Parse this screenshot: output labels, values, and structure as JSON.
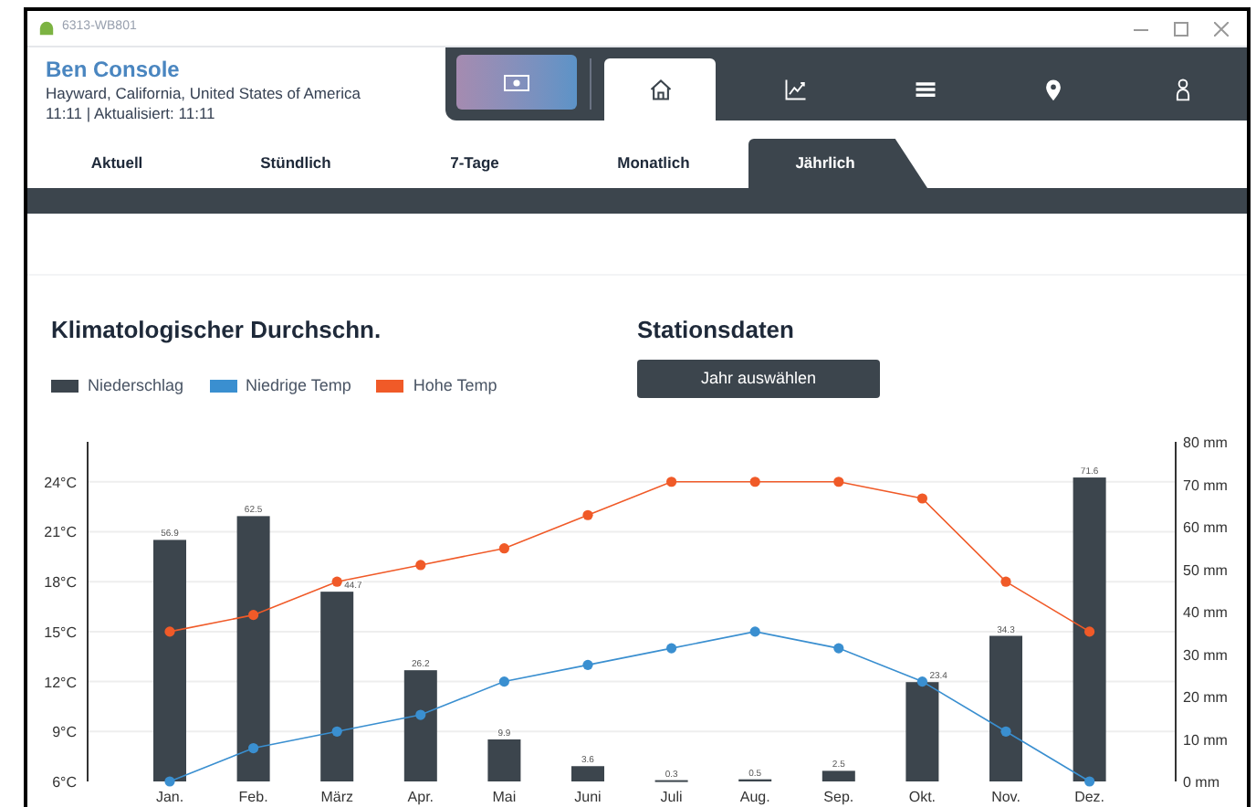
{
  "window": {
    "title": "6313-WB801"
  },
  "header": {
    "station": "Ben Console",
    "location": "Hayward, California, United States of America",
    "updated": "11:11 | Aktualisiert: 11:11"
  },
  "nav": [
    {
      "kind": "home",
      "selected": true
    },
    {
      "kind": "chart",
      "selected": false
    },
    {
      "kind": "list",
      "selected": false
    },
    {
      "kind": "pin",
      "selected": false
    },
    {
      "kind": "person",
      "selected": false
    }
  ],
  "tabs": [
    {
      "label": "Aktuell",
      "selected": false
    },
    {
      "label": "Stündlich",
      "selected": false
    },
    {
      "label": "7-Tage",
      "selected": false
    },
    {
      "label": "Monatlich",
      "selected": false
    },
    {
      "label": "Jährlich",
      "selected": true
    }
  ],
  "climate": {
    "title": "Klimatologischer Durchschn.",
    "chart_data": {
      "type": "bar",
      "categories": [
        "Jan.",
        "Feb.",
        "März",
        "Apr.",
        "Mai",
        "Juni",
        "Juli",
        "Aug.",
        "Sep.",
        "Okt.",
        "Nov.",
        "Dez."
      ],
      "series": [
        {
          "name": "Niederschlag",
          "type": "bar",
          "axis": "y2",
          "color": "#3c454d",
          "values": [
            56.9,
            62.5,
            44.7,
            26.2,
            9.9,
            3.6,
            0.3,
            0.5,
            2.5,
            23.4,
            34.3,
            71.6
          ],
          "value_labels": [
            "56.9",
            "62.5",
            "44.7",
            "26.2",
            "9.9",
            "3.6",
            "0.3",
            "0.5",
            "2.5",
            "23.4",
            "34.3",
            "71.6"
          ]
        },
        {
          "name": "Niedrige Temp",
          "type": "line",
          "marker": "circle",
          "color": "#3a8fd0",
          "values": [
            6,
            8,
            9,
            10,
            12,
            13,
            14,
            15,
            14,
            12,
            9,
            6
          ]
        },
        {
          "name": "Hohe Temp",
          "type": "line",
          "marker": "circle",
          "color": "#f05a28",
          "values": [
            15,
            16,
            18,
            19,
            20,
            22,
            24,
            24,
            24,
            23,
            18,
            15
          ]
        }
      ],
      "ylim": [
        6,
        26.4
      ],
      "y2lim": [
        0,
        80
      ],
      "stacked": false,
      "grid": true,
      "yticks": [
        {
          "value": 6,
          "label": "6°C"
        },
        {
          "value": 9,
          "label": "9°C"
        },
        {
          "value": 12,
          "label": "12°C"
        },
        {
          "value": 15,
          "label": "15°C"
        },
        {
          "value": 18,
          "label": "18°C"
        },
        {
          "value": 21,
          "label": "21°C"
        },
        {
          "value": 24,
          "label": "24°C"
        }
      ],
      "y2ticks": [
        {
          "value": 0,
          "label": "0 mm"
        },
        {
          "value": 10,
          "label": "10 mm"
        },
        {
          "value": 20,
          "label": "20 mm"
        },
        {
          "value": 30,
          "label": "30 mm"
        },
        {
          "value": 40,
          "label": "40 mm"
        },
        {
          "value": 50,
          "label": "50 mm"
        },
        {
          "value": 60,
          "label": "60 mm"
        },
        {
          "value": 70,
          "label": "70 mm"
        },
        {
          "value": 80,
          "label": "80 mm"
        }
      ]
    }
  },
  "station_data": {
    "title": "Stationsdaten",
    "button": "Jahr auswählen"
  }
}
